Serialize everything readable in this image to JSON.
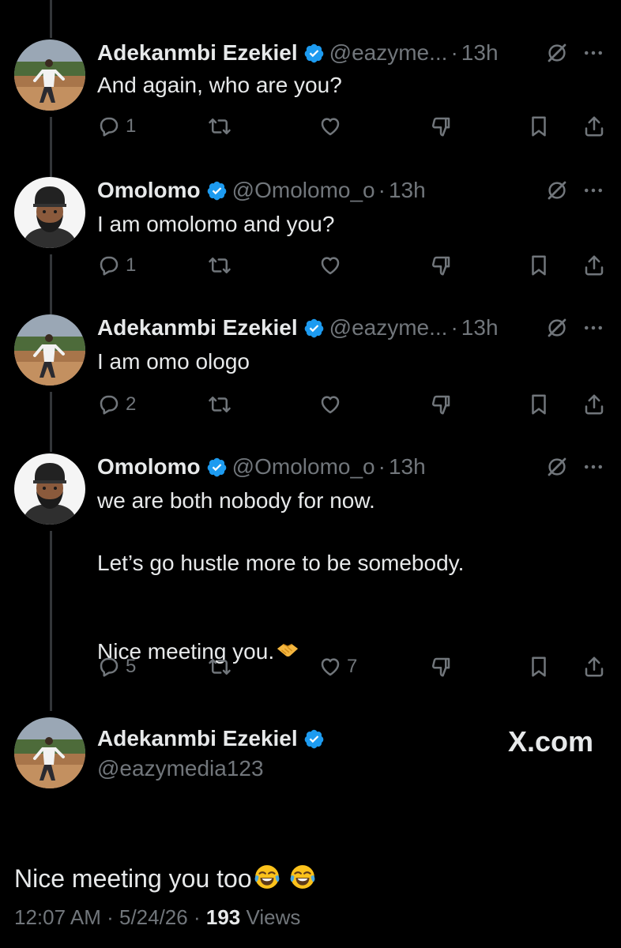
{
  "tweets": [
    {
      "author": "Adekanmbi Ezekiel",
      "handle": "@eazyme...",
      "time": "13h",
      "text": "And again, who are you?",
      "replies": "1",
      "retweets": "",
      "likes": "",
      "avatar": "landscape-photo"
    },
    {
      "author": "Omolomo",
      "handle": "@Omolomo_o",
      "time": "13h",
      "text": "I am omolomo and you?",
      "replies": "1",
      "retweets": "",
      "likes": "",
      "avatar": "cartoon-man"
    },
    {
      "author": "Adekanmbi Ezekiel",
      "handle": "@eazyme...",
      "time": "13h",
      "text": "I am omo ologo",
      "replies": "2",
      "retweets": "",
      "likes": "",
      "avatar": "landscape-photo"
    },
    {
      "author": "Omolomo",
      "handle": "@Omolomo_o",
      "time": "13h",
      "text_line1": "we are both nobody for now.",
      "text_line2": "Let’s go hustle more to be somebody.",
      "text_line3": "Nice meeting you.",
      "text_line3_emoji": "handshake",
      "replies": "5",
      "retweets": "",
      "likes": "7",
      "avatar": "cartoon-man"
    }
  ],
  "main_tweet": {
    "author": "Adekanmbi Ezekiel",
    "handle": "@eazymedia123",
    "text": "Nice meeting you too",
    "text_emoji": "face-with-tears-of-joy ×2",
    "time": "12:07 AM",
    "date": "5/24/26",
    "views_count": "193",
    "views_label": "Views",
    "watermark": "X.com"
  },
  "colors": {
    "background": "#000000",
    "text": "#e7e9ea",
    "secondary": "#71767b",
    "verified": "#1d9bf0",
    "thread_line": "#333639"
  },
  "icons": [
    "reply-icon",
    "retweet-icon",
    "like-icon",
    "downvote-icon",
    "bookmark-icon",
    "share-icon",
    "grok-icon",
    "more-icon",
    "verified-badge-icon"
  ]
}
